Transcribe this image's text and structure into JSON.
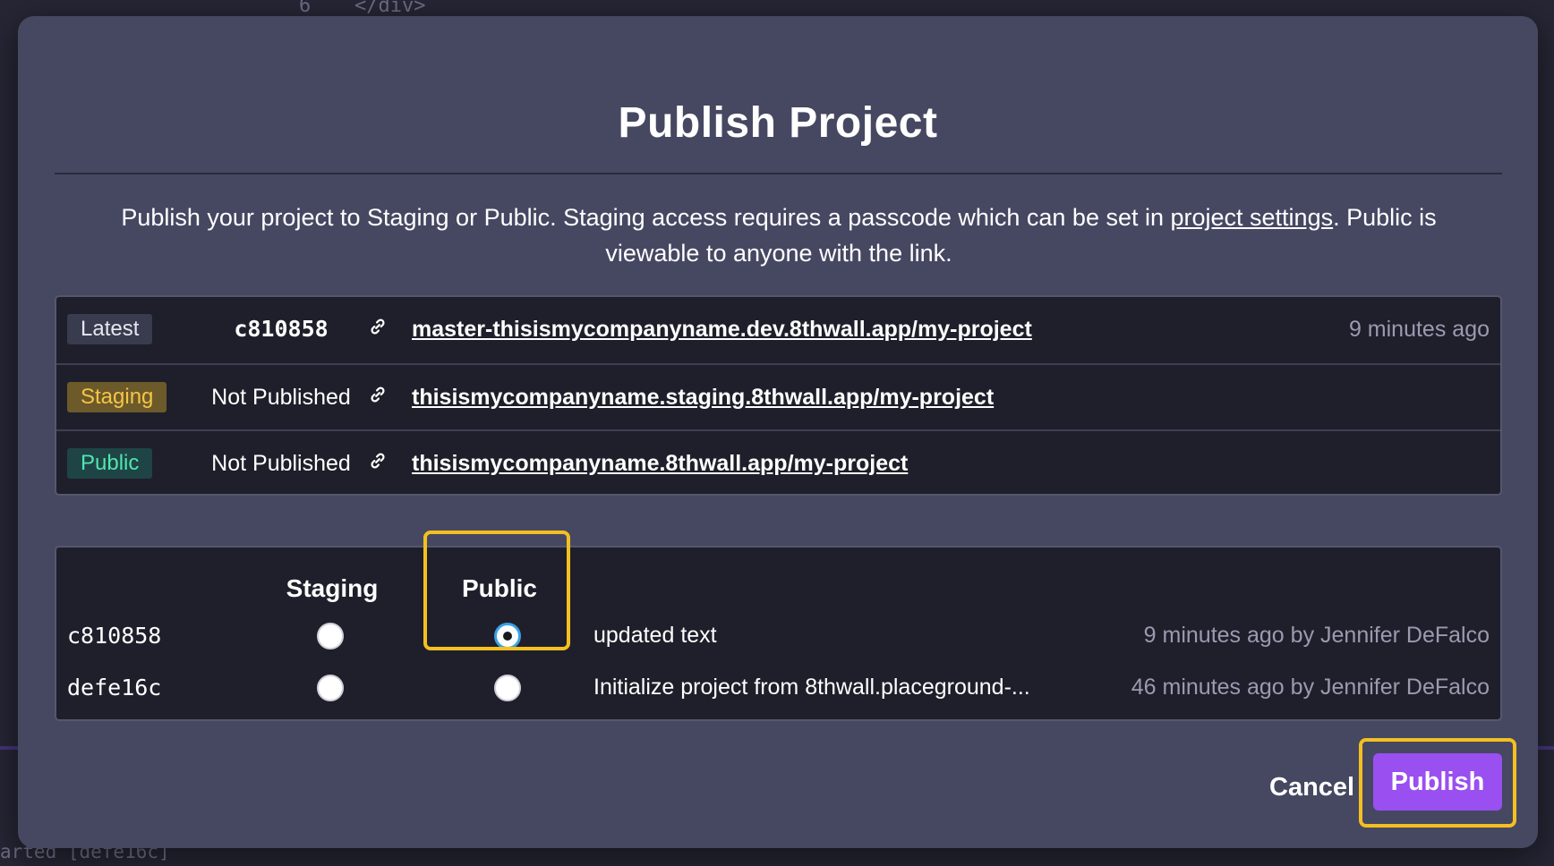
{
  "background": {
    "code_line_number": "6",
    "code_snippet": "</div>",
    "footer_text": "arted  [defe16c]"
  },
  "modal": {
    "title": "Publish Project",
    "description_before": "Publish your project to Staging or Public. Staging access requires a passcode which can be set in ",
    "description_link": "project settings",
    "description_after": ". Public is viewable to anyone with the link.",
    "status_rows": [
      {
        "badge": "Latest",
        "value": "c810858",
        "url": "master-thisismycompanyname.dev.8thwall.app/my-project",
        "time": "9 minutes ago"
      },
      {
        "badge": "Staging",
        "value": "Not Published",
        "url": "thisismycompanyname.staging.8thwall.app/my-project",
        "time": ""
      },
      {
        "badge": "Public",
        "value": "Not Published",
        "url": "thisismycompanyname.8thwall.app/my-project",
        "time": ""
      }
    ],
    "publish_table": {
      "col_staging": "Staging",
      "col_public": "Public",
      "commits": [
        {
          "hash": "c810858",
          "staging_selected": false,
          "public_selected": true,
          "message": "updated text",
          "meta": "9 minutes ago by Jennifer DeFalco"
        },
        {
          "hash": "defe16c",
          "staging_selected": false,
          "public_selected": false,
          "message": "Initialize project from 8thwall.placeground-...",
          "meta": "46 minutes ago by Jennifer DeFalco"
        }
      ]
    },
    "cancel_label": "Cancel",
    "publish_label": "Publish"
  },
  "colors": {
    "modal_bg": "#464862",
    "table_bg": "#1f1f2b",
    "highlight": "#f4c020",
    "publish_button": "#9a4ff0",
    "staging_badge_text": "#f4c547",
    "public_badge_text": "#4fe6b0"
  },
  "icons": {
    "link": "link-icon"
  }
}
